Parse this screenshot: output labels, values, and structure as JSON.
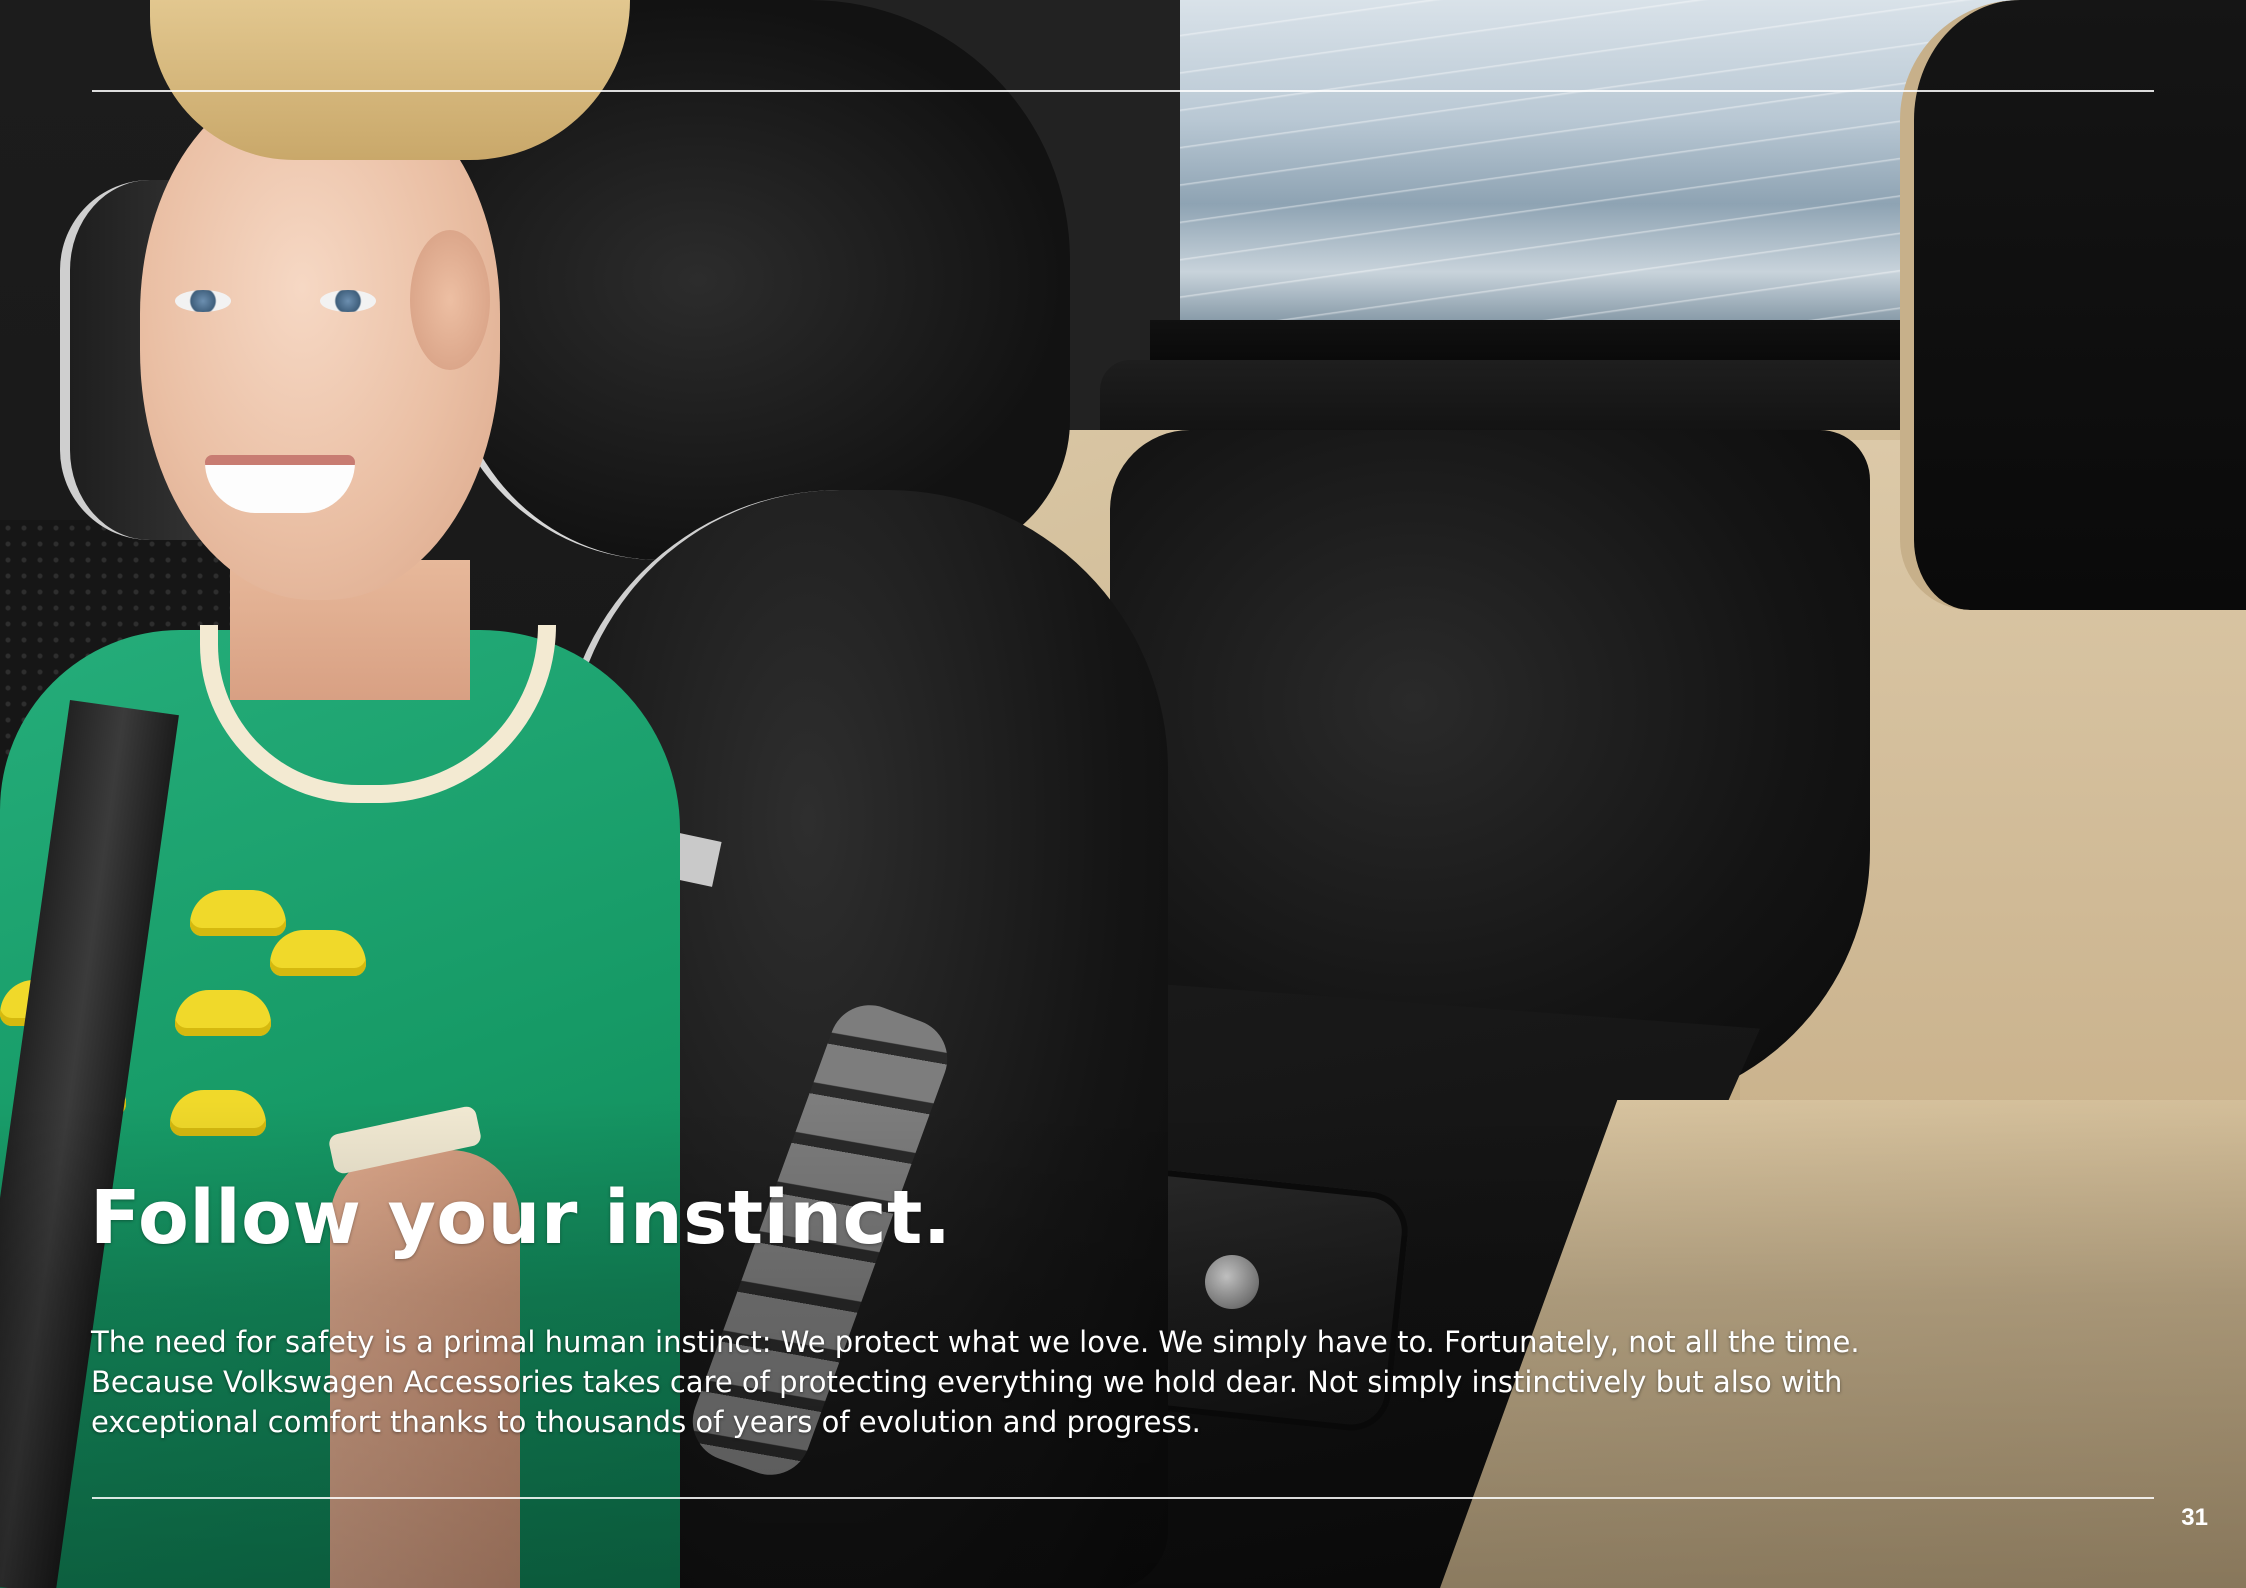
{
  "page": {
    "headline": "Follow your instinct.",
    "body_lines": [
      "The need for safety is a primal human instinct: We protect what we love. We simply have to. Fortunately, not all the time.",
      "Because Volkswagen Accessories takes care of protecting everything we hold dear. Not simply instinctively but also with",
      "exceptional comfort thanks to thousands of years of evolution and progress."
    ],
    "page_number": "31"
  },
  "colors": {
    "text": "#ffffff",
    "rule": "#ffffff",
    "shirt_green": "#169a66",
    "seat_tan": "#c9b28a",
    "seat_black": "#141414"
  }
}
